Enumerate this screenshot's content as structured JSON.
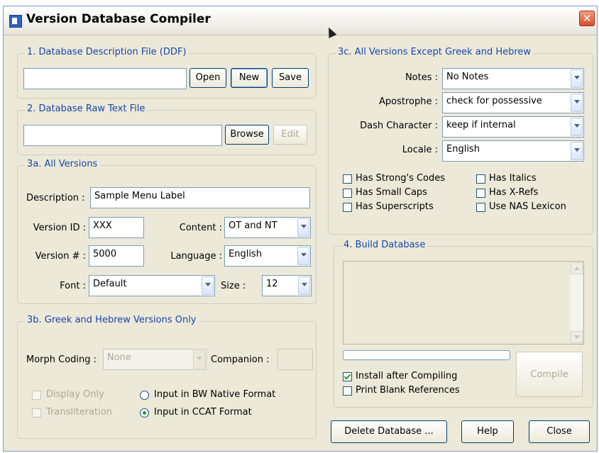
{
  "window": {
    "title": "Version Database Compiler"
  },
  "ddf": {
    "legend": "1. Database Description File (DDF)",
    "path": "",
    "open_label": "Open",
    "new_label": "New",
    "save_label": "Save"
  },
  "raw": {
    "legend": "2. Database Raw Text File",
    "path": "",
    "browse_label": "Browse",
    "edit_label": "Edit"
  },
  "all_versions": {
    "legend": "3a. All Versions",
    "description_label": "Description :",
    "description_value": "Sample Menu Label",
    "version_id_label": "Version ID :",
    "version_id_value": "XXX",
    "version_no_label": "Version # :",
    "version_no_value": "5000",
    "content_label": "Content :",
    "content_value": "OT and NT",
    "language_label": "Language :",
    "language_value": "English",
    "font_label": "Font :",
    "font_value": "Default",
    "size_label": "Size :",
    "size_value": "12"
  },
  "greek": {
    "legend": "3b. Greek and Hebrew Versions Only",
    "morph_label": "Morph Coding :",
    "morph_value": "None",
    "companion_label": "Companion :",
    "companion_value": "",
    "display_only": "Display Only",
    "transliteration": "Transliteration",
    "bw_format": "Input in BW Native Format",
    "ccat_format": "Input in CCAT Format"
  },
  "except": {
    "legend": "3c. All Versions Except Greek and Hebrew",
    "notes_label": "Notes :",
    "notes_value": "No Notes",
    "apostrophe_label": "Apostrophe :",
    "apostrophe_value": "check for possessive",
    "dash_label": "Dash Character :",
    "dash_value": "keep if internal",
    "locale_label": "Locale :",
    "locale_value": "English",
    "strongs": "Has Strong's Codes",
    "small_caps": "Has Small Caps",
    "superscripts": "Has Superscripts",
    "italics": "Has Italics",
    "xrefs": "Has X-Refs",
    "nas_lexicon": "Use NAS Lexicon"
  },
  "build": {
    "legend": "4. Build Database",
    "progress": 0,
    "install_label": "Install after Compiling",
    "install_checked": true,
    "blank_refs_label": "Print Blank References",
    "compile_label": "Compile"
  },
  "footer": {
    "delete_label": "Delete Database ...",
    "help_label": "Help",
    "close_label": "Close"
  },
  "icons": {
    "app": "app-icon",
    "close": "close-icon",
    "dropdown": "chevron-down-icon",
    "cursor": "mouse-cursor-icon"
  }
}
